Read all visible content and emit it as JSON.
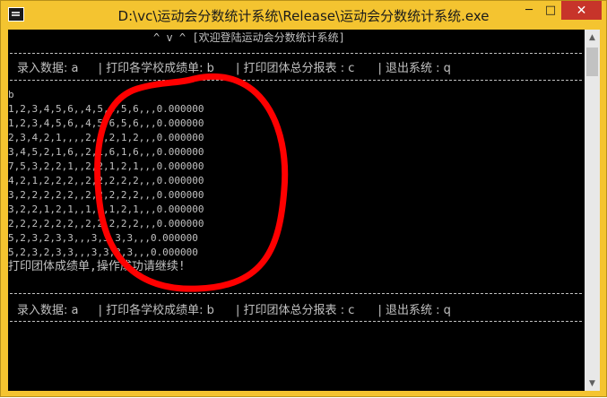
{
  "window": {
    "title": "D:\\vc\\运动会分数统计系统\\Release\\运动会分数统计系统.exe",
    "controls": {
      "minimize": "─",
      "maximize": "□",
      "close": "✕"
    }
  },
  "console": {
    "header": "^ v ^ [欢迎登陆运动会分数统计系统]",
    "menu": {
      "enter": "录入数据: a",
      "print_school": "| 打印各学校成绩单:  b",
      "print_team": "| 打印团体总分报表 :  c",
      "exit": "| 退出系统 :  q"
    },
    "input_echo": "b",
    "rows": [
      "1,2,3,4,5,6,,4,5,6,5,6,,,0.000000",
      "1,2,3,4,5,6,,4,5,6,5,6,,,0.000000",
      "2,3,4,2,1,,,,2,1,2,1,2,,,0.000000",
      "3,4,5,2,1,6,,2,1,6,1,6,,,0.000000",
      "7,5,3,2,2,1,,2,2,1,2,1,,,0.000000",
      "4,2,1,2,2,2,,2,2,2,2,2,,,0.000000",
      "3,2,2,2,2,2,,2,2,2,2,2,,,0.000000",
      "3,2,2,1,2,1,,1,2,1,2,1,,,0.000000",
      "2,2,2,2,2,2,,2,2,2,2,2,,,0.000000",
      "5,2,3,2,3,3,,,3,3,3,3,,,0.000000",
      "5,2,3,2,3,3,,,3,3,3,3,,,0.000000"
    ],
    "status": "打印团体成绩单,操作成功请继续!"
  },
  "colors": {
    "title_bar": "#f4c430",
    "close_button": "#c7342a",
    "console_bg": "#000000",
    "console_text": "#c0c0c0",
    "annotation": "#ff0000"
  },
  "icons": {
    "app": "console-app-icon",
    "scroll_up": "arrow-up-icon",
    "scroll_down": "arrow-down-icon"
  }
}
